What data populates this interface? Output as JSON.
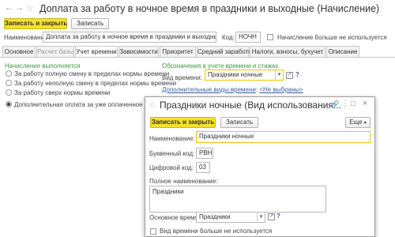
{
  "main": {
    "title": "Доплата за работу в ночное время в праздники и выходные (Начисление)",
    "toolbar": {
      "save_close": "Записать и закрыть",
      "save": "Записать"
    },
    "name_label": "Наименование:",
    "name_value": "Доплата за работу в ночное время в праздники и выходные",
    "code_label": "Код:",
    "code_value": "НОЧН",
    "unused_label": "Начисление больше не используется",
    "tabs": [
      {
        "label": "Основное"
      },
      {
        "label": "Расчет базы"
      },
      {
        "label": "Учет времени"
      },
      {
        "label": "Зависимости"
      },
      {
        "label": "Приоритет"
      },
      {
        "label": "Средний заработок"
      },
      {
        "label": "Налоги, взносы, бухучет"
      },
      {
        "label": "Описание"
      }
    ],
    "performed_heading": "Начисление выполняется",
    "radio_options": [
      "За работу полную смену в пределах нормы времени",
      "За работу неполную смену в пределах нормы времени",
      "За работу сверх нормы времени",
      "Дополнительная оплата за уже оплаченное время"
    ],
    "time_heading": "Обозначения в учете времени и стажах",
    "time_type_label": "Вид времени:",
    "time_type_value": "Праздники ночные",
    "extra_link": "Дополнительные виды времени",
    "extra_link_value": "<Не выбраны>"
  },
  "dialog": {
    "title": "Праздники ночные (Вид использования...",
    "toolbar": {
      "save_close": "Записать и закрыть",
      "save": "Записать",
      "more": "Еще"
    },
    "name_label": "Наименование:",
    "name_value": "Праздники ночные",
    "letter_label": "Буквенный код:",
    "letter_value": "РВН",
    "digit_label": "Цифровой код:",
    "digit_value": "03",
    "fullname_label": "Полное наименование:",
    "fullname_value": "Праздники",
    "base_label": "Основное время:",
    "base_value": "Праздники",
    "unused_label": "Вид времени больше не используется"
  },
  "icons": {
    "star": "star-icon",
    "forward": "arrow-right-icon",
    "back": "arrow-left-icon",
    "link": "link-icon",
    "menu": "menu-icon",
    "close": "close-icon",
    "help": "help-icon"
  },
  "colors": {
    "accent_yellow": "#f5e02a",
    "green": "#3b9b3b",
    "link": "#3b5ea8"
  }
}
